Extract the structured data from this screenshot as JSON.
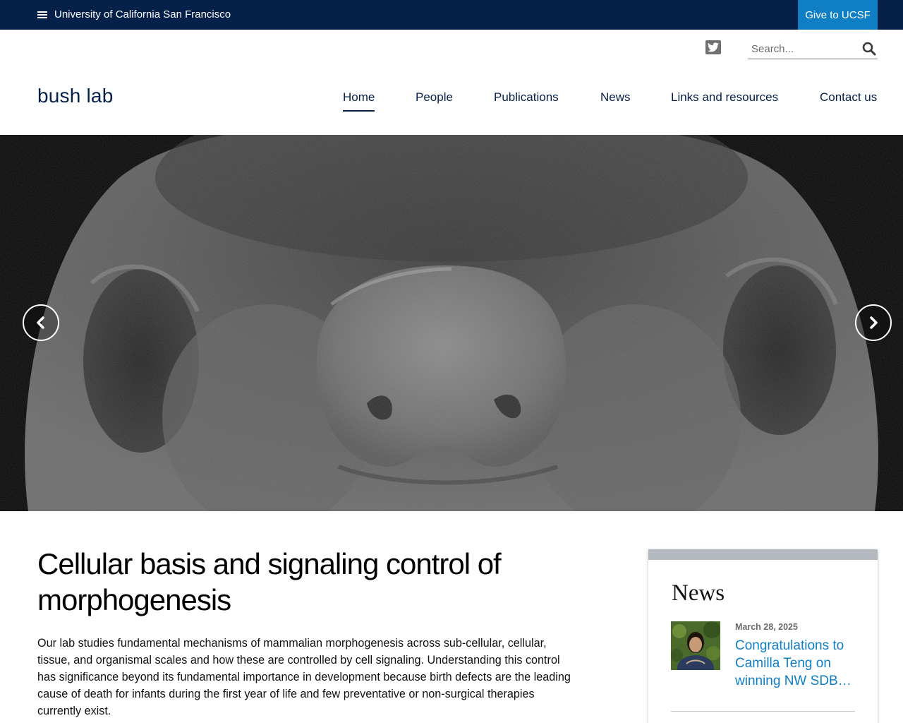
{
  "topbar": {
    "university_label": "University of California San Francisco",
    "give_label": "Give to UCSF"
  },
  "utility": {
    "search_placeholder": "Search..."
  },
  "site": {
    "logo": "bush lab"
  },
  "nav": {
    "items": [
      {
        "label": "Home",
        "active": true
      },
      {
        "label": "People"
      },
      {
        "label": "Publications"
      },
      {
        "label": "News"
      },
      {
        "label": "Links and resources"
      },
      {
        "label": "Contact us"
      }
    ]
  },
  "main": {
    "title": "Cellular basis and signaling control of morphogenesis",
    "body": "Our lab studies fundamental mechanisms of mammalian morphogenesis across sub-cellular, cellular, tissue, and organismal scales and how these are controlled by cell signaling. Understanding this control has significance beyond its fundamental importance in development because birth defects are the leading cause of death for infants during the first year of life and few preventative or non-surgical therapies currently exist."
  },
  "news": {
    "heading": "News",
    "items": [
      {
        "date": "March 28, 2025",
        "title": "Congratulations to Camilla Teng on winning NW SDB…"
      }
    ]
  },
  "colors": {
    "navy": "#052049",
    "accent_blue": "#0f7ec4",
    "card_bar": "#b4b9bf"
  },
  "icons": {
    "menu": "hamburger-icon",
    "social": "twitter-icon",
    "search": "search-icon",
    "carousel_prev": "chevron-left-icon",
    "carousel_next": "chevron-right-icon"
  }
}
